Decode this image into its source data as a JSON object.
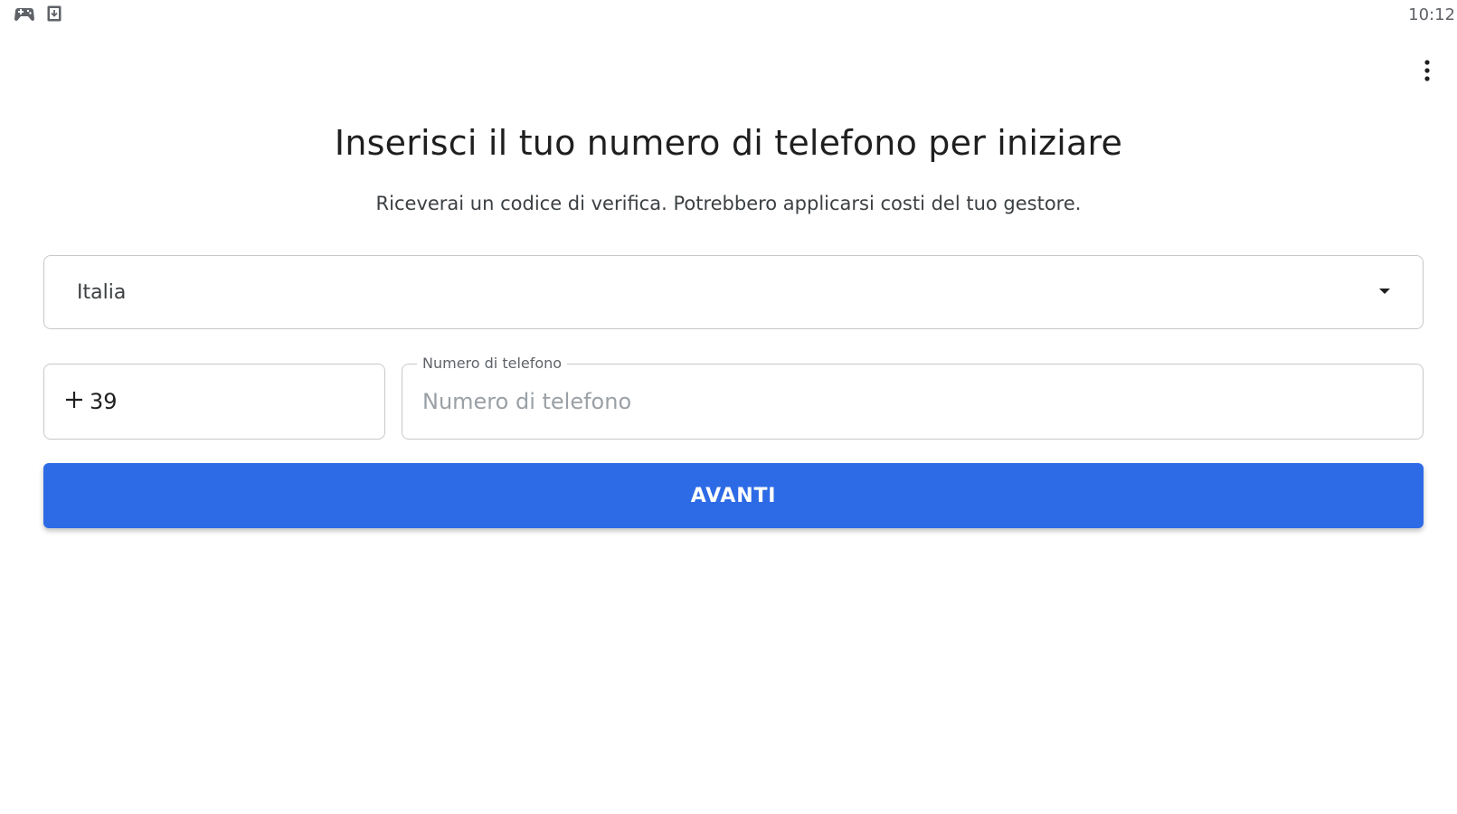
{
  "status_bar": {
    "icons": [
      "gamepad-icon",
      "download-icon"
    ],
    "time": "10:12"
  },
  "header": {
    "menu_icon": "more-vert-icon"
  },
  "main": {
    "title": "Inserisci il tuo numero di telefono per iniziare",
    "subtitle": "Riceverai un codice di verifica. Potrebbero applicarsi costi del tuo gestore.",
    "country_select": {
      "value": "Italia",
      "icon": "dropdown-arrow-icon"
    },
    "country_code": {
      "prefix_icon": "plus-icon",
      "value": "39"
    },
    "phone_field": {
      "label": "Numero di telefono",
      "placeholder": "Numero di telefono",
      "value": ""
    },
    "next_button": {
      "label": "AVANTI",
      "color": "#2d6be6"
    }
  }
}
